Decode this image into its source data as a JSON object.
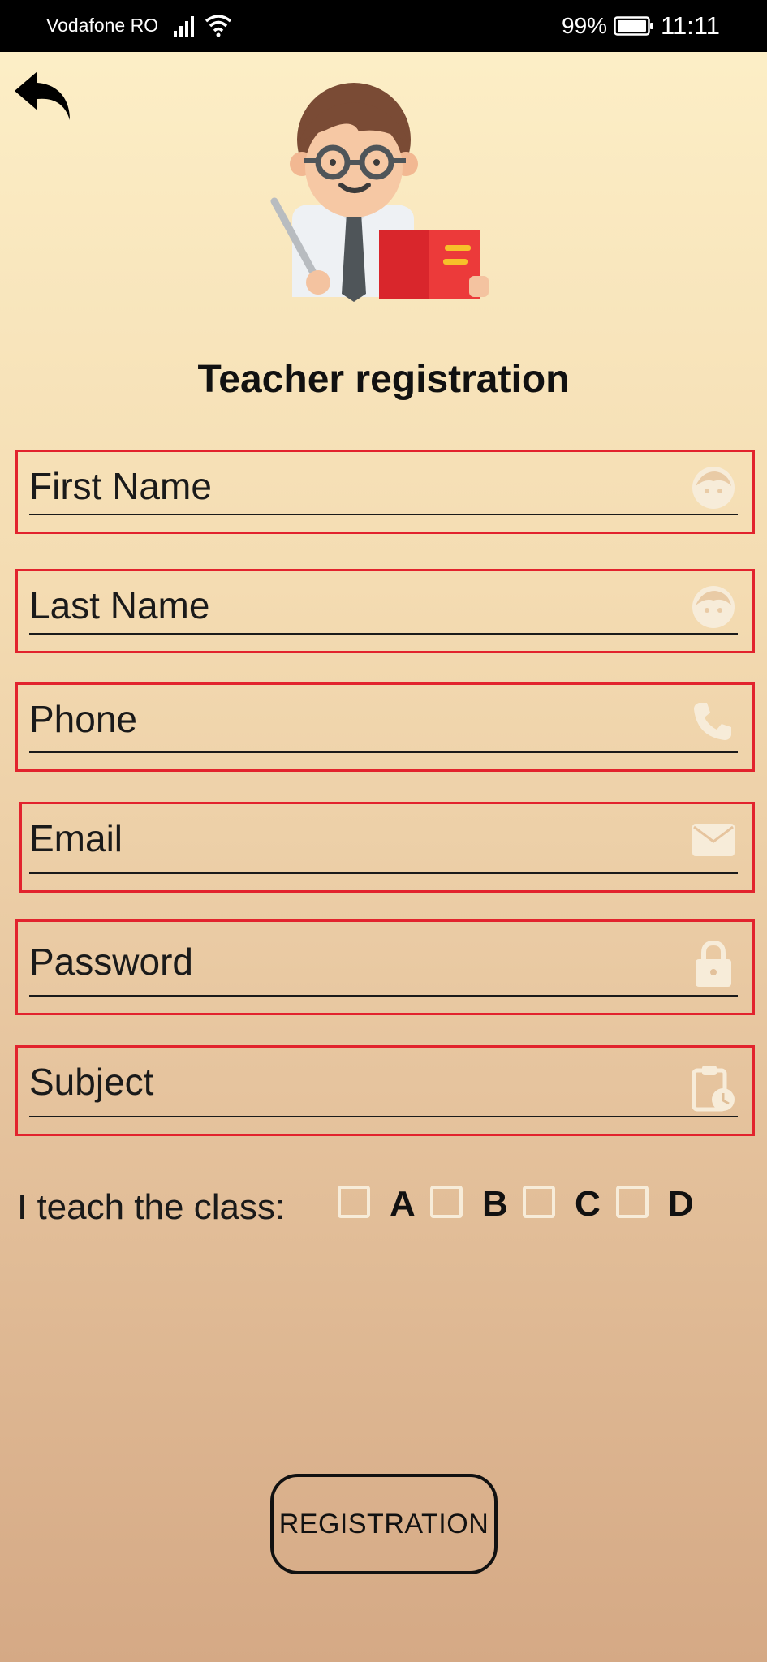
{
  "status_bar": {
    "carrier": "Vodafone RO",
    "battery_percent": "99%",
    "time": "11:11"
  },
  "header": {
    "title": "Teacher registration"
  },
  "form": {
    "fields": [
      {
        "placeholder": "First Name",
        "icon": "face-icon"
      },
      {
        "placeholder": "Last Name",
        "icon": "face-icon"
      },
      {
        "placeholder": "Phone",
        "icon": "phone-icon"
      },
      {
        "placeholder": "Email",
        "icon": "mail-icon"
      },
      {
        "placeholder": "Password",
        "icon": "lock-icon"
      },
      {
        "placeholder": "Subject",
        "icon": "clipboard-clock-icon"
      }
    ],
    "class_label": "I teach the class:",
    "classes": [
      {
        "label": "A",
        "checked": false
      },
      {
        "label": "B",
        "checked": false
      },
      {
        "label": "C",
        "checked": false
      },
      {
        "label": "D",
        "checked": false
      }
    ],
    "submit_label": "REGISTRATION"
  },
  "colors": {
    "field_border": "#e2232d",
    "icon_fill": "#f7ecd9"
  }
}
